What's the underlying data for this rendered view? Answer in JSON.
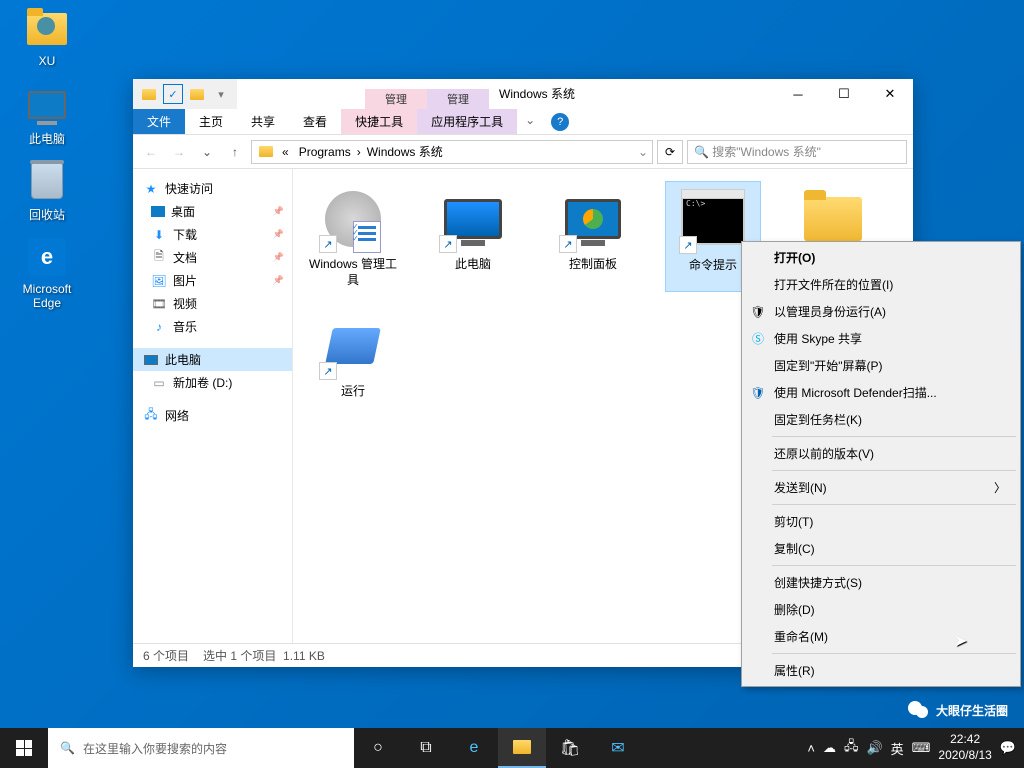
{
  "desktop": {
    "icons": [
      {
        "label": "XU"
      },
      {
        "label": "此电脑"
      },
      {
        "label": "回收站"
      },
      {
        "label": "Microsoft Edge"
      }
    ]
  },
  "window": {
    "title": "Windows 系统",
    "context_tabs": [
      "管理",
      "管理"
    ],
    "ribbon": {
      "file": "文件",
      "home": "主页",
      "share": "共享",
      "view": "查看",
      "ctx1": "快捷工具",
      "ctx2": "应用程序工具"
    },
    "address": {
      "seg1": "Programs",
      "seg2": "Windows 系统"
    },
    "search_placeholder": "搜索\"Windows 系统\"",
    "nav": {
      "quick": "快速访问",
      "desktop": "桌面",
      "downloads": "下载",
      "documents": "文档",
      "pictures": "图片",
      "videos": "视频",
      "music": "音乐",
      "thispc": "此电脑",
      "newvol": "新加卷 (D:)",
      "network": "网络"
    },
    "items": {
      "admin": "Windows 管理工具",
      "thispc": "此电脑",
      "cp": "控制面板",
      "cmd": "命令提示",
      "run": "运行"
    },
    "status": {
      "count": "6 个项目",
      "selected": "选中 1 个项目",
      "size": "1.11 KB"
    }
  },
  "ctx": {
    "open": "打开(O)",
    "openloc": "打开文件所在的位置(I)",
    "admin": "以管理员身份运行(A)",
    "skype": "使用 Skype 共享",
    "pinstart": "固定到\"开始\"屏幕(P)",
    "defender": "使用 Microsoft Defender扫描...",
    "pintask": "固定到任务栏(K)",
    "restore": "还原以前的版本(V)",
    "sendto": "发送到(N)",
    "cut": "剪切(T)",
    "copy": "复制(C)",
    "shortcut": "创建快捷方式(S)",
    "delete": "删除(D)",
    "rename": "重命名(M)",
    "props": "属性(R)"
  },
  "taskbar": {
    "search_placeholder": "在这里输入你要搜索的内容",
    "ime": "英",
    "time": "22:42",
    "date": "2020/8/13"
  },
  "watermark": "大眼仔生活圈"
}
